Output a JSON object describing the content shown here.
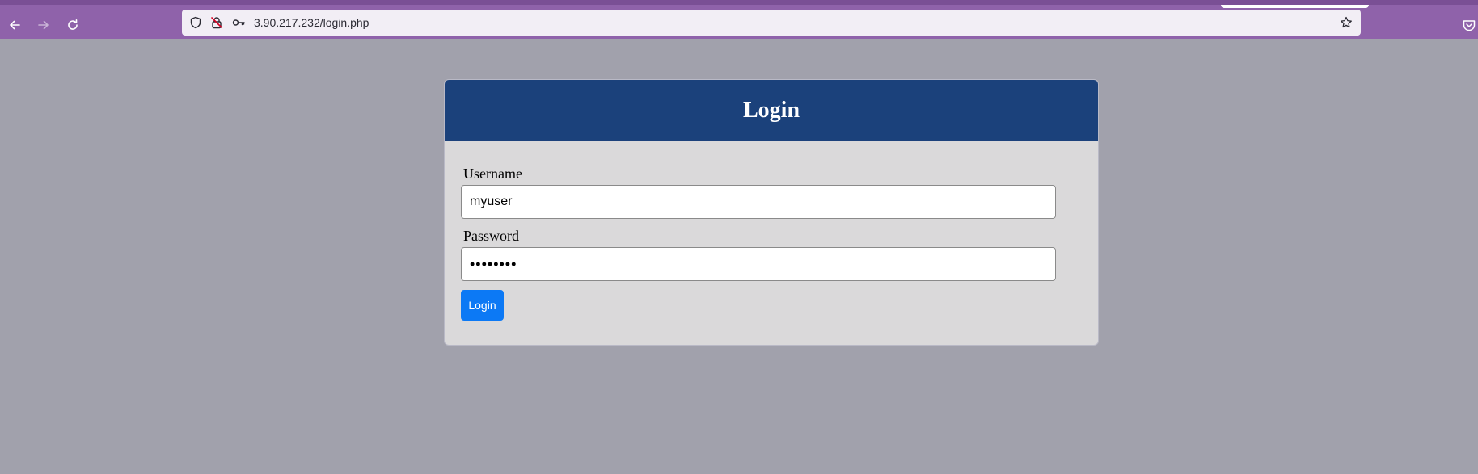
{
  "browser": {
    "url": "3.90.217.232/login.php",
    "icons": {
      "back": "back-arrow-icon",
      "forward": "forward-arrow-icon",
      "reload": "reload-icon",
      "tracking": "tracking-protection-shield-icon",
      "insecure": "insecure-connection-lock-icon",
      "key": "saved-password-key-icon",
      "bookmark": "bookmark-star-icon",
      "pocket": "pocket-icon"
    },
    "colors": {
      "toolbar": "#8f62aa",
      "url_bar": "#f2eef5"
    }
  },
  "page": {
    "background": "#a1a1ac",
    "form": {
      "title": "Login",
      "username_label": "Username",
      "username_value": "myuser",
      "password_label": "Password",
      "password_value": "12345678",
      "submit_label": "Login"
    },
    "colors": {
      "header": "#1b417b",
      "card": "#dad9da",
      "button": "#0c79f5"
    }
  }
}
